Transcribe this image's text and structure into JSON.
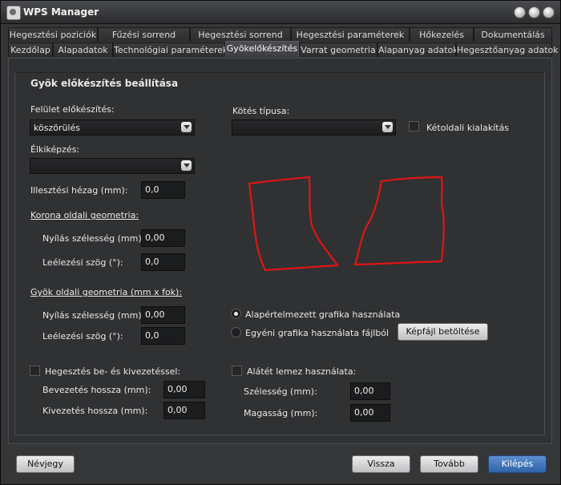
{
  "window": {
    "title": "WPS Manager"
  },
  "tabs_row1": [
    "Hegesztési poziciók",
    "Fűzési sorrend",
    "Hegesztési sorrend",
    "Hegesztési paraméterek",
    "Hőkezelés",
    "Dokumentálás"
  ],
  "tabs_row2": [
    "Kezdőlap",
    "Alapadatok",
    "Technológiai paraméterek",
    "Gyökelőkészítés",
    "Varrat geometria",
    "Alapanyag adatok",
    "Hegesztőanyag adatok"
  ],
  "section_title": "Gyök előkészítés beállítása",
  "surface": {
    "label": "Felület előkészítés:",
    "value": "köszörülés"
  },
  "edge": {
    "label": "Élkiképzés:",
    "value": ""
  },
  "joint": {
    "label": "Kötés típusa:",
    "value": ""
  },
  "double_sided": {
    "label": "Kétoldali kialakítás",
    "checked": false
  },
  "gap": {
    "label": "Illesztési hézag (mm):",
    "value": "0,0"
  },
  "crown": {
    "title": "Korona oldali geometria:",
    "opening_label": "Nyílás szélesség (mm):",
    "opening_value": "0,00",
    "angle_label": "Leélezési szög (°):",
    "angle_value": "0,0"
  },
  "root": {
    "title": "Gyök oldali geometria (mm x fok):",
    "opening_label": "Nyílás szélesség (mm):",
    "opening_value": "0,00",
    "angle_label": "Leélezési szög (°):",
    "angle_value": "0,0"
  },
  "graphics": {
    "default_label": "Alapértelmezett grafika használata",
    "custom_label": "Egyéni grafika használata fájlból",
    "load_button": "Képfájl betöltése",
    "selected": "default"
  },
  "runout": {
    "label": "Hegesztés be- és kivezetéssel:",
    "checked": false,
    "in_label": "Bevezetés hossza (mm):",
    "in_value": "0,00",
    "out_label": "Kivezetés hossza (mm):",
    "out_value": "0,00"
  },
  "backing": {
    "label": "Alátét lemez használata:",
    "checked": false,
    "width_label": "Szélesség (mm):",
    "width_value": "0,00",
    "height_label": "Magasság (mm):",
    "height_value": "0,00"
  },
  "buttons": {
    "about": "Névjegy",
    "back": "Vissza",
    "next": "Tovább",
    "exit": "Kilépés"
  },
  "colors": {
    "sketch": "#e01414",
    "accent": "#3b6fb6"
  }
}
